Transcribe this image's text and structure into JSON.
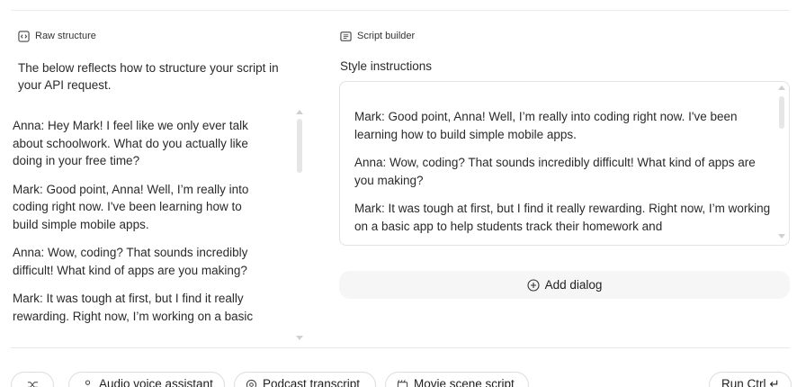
{
  "left": {
    "header_label": "Raw structure",
    "description": "The below reflects how to structure your script in your API request.",
    "lines": [
      "Anna: Hey Mark! I feel like we only ever talk about schoolwork. What do you actually like doing in your free time?",
      "Mark: Good point, Anna! Well, I’m really into coding right now. I've been learning how to build simple mobile apps.",
      "Anna: Wow, coding? That sounds incredibly difficult! What kind of apps are you making?",
      "Mark: It was tough at first, but I find it really rewarding. Right now, I’m working on a basic"
    ]
  },
  "right": {
    "header_label": "Script builder",
    "style_label": "Style instructions",
    "textarea_lines": [
      "Mark: Good point, Anna! Well, I’m really into coding right now. I've been learning how to build simple mobile apps.",
      "Anna: Wow, coding? That sounds incredibly difficult! What kind of apps are you making?",
      "Mark: It was tough at first, but I find it really rewarding. Right now, I’m working on a basic app to help students track their homework and"
    ],
    "add_dialog_label": "Add dialog"
  },
  "chips": {
    "audio_voice_assistant": "Audio voice assistant",
    "podcast_transcript": "Podcast transcript",
    "movie_scene_script": "Movie scene script",
    "run": "Run Ctrl ↵"
  },
  "icons": {
    "raw_structure": "code-box-icon",
    "script_builder": "document-lines-icon",
    "add": "plus-circle-icon",
    "shuffle": "shuffle-icon",
    "person": "person-icon",
    "podcast": "podcast-icon",
    "movie": "clapperboard-icon"
  }
}
